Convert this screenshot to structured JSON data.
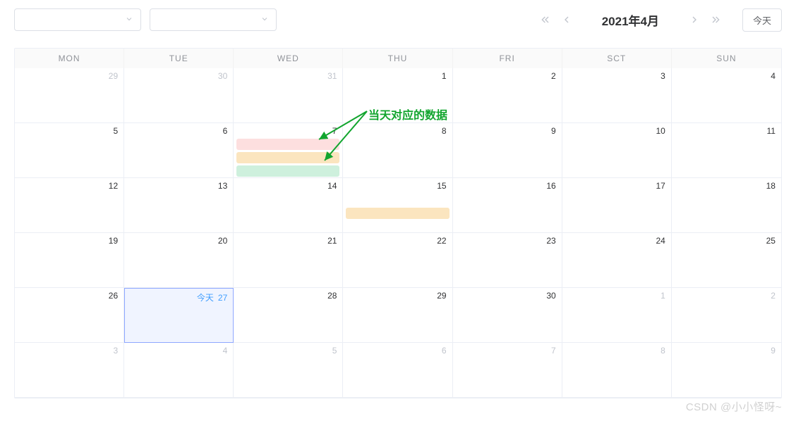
{
  "toolbar": {
    "select1_placeholder": " ",
    "select2_placeholder": " ",
    "month_label": "2021年4月",
    "today_button": "今天"
  },
  "weekdays": [
    "MON",
    "TUE",
    "WED",
    "THU",
    "FRI",
    "SCT",
    "SUN"
  ],
  "cells": [
    {
      "n": "29",
      "muted": true
    },
    {
      "n": "30",
      "muted": true
    },
    {
      "n": "31",
      "muted": true
    },
    {
      "n": "1"
    },
    {
      "n": "2"
    },
    {
      "n": "3"
    },
    {
      "n": "4"
    },
    {
      "n": "5"
    },
    {
      "n": "6"
    },
    {
      "n": "7",
      "events": [
        "pink",
        "orange",
        "green"
      ]
    },
    {
      "n": "8"
    },
    {
      "n": "9"
    },
    {
      "n": "10"
    },
    {
      "n": "11"
    },
    {
      "n": "12"
    },
    {
      "n": "13"
    },
    {
      "n": "14"
    },
    {
      "n": "15",
      "events": [
        "orange"
      ],
      "ev_top": true
    },
    {
      "n": "16"
    },
    {
      "n": "17"
    },
    {
      "n": "18"
    },
    {
      "n": "19"
    },
    {
      "n": "20"
    },
    {
      "n": "21"
    },
    {
      "n": "22"
    },
    {
      "n": "23"
    },
    {
      "n": "24"
    },
    {
      "n": "25"
    },
    {
      "n": "26"
    },
    {
      "n": "27",
      "today": true,
      "today_label": "今天"
    },
    {
      "n": "28"
    },
    {
      "n": "29"
    },
    {
      "n": "30"
    },
    {
      "n": "1",
      "muted": true
    },
    {
      "n": "2",
      "muted": true
    },
    {
      "n": "3",
      "muted": true
    },
    {
      "n": "4",
      "muted": true
    },
    {
      "n": "5",
      "muted": true
    },
    {
      "n": "6",
      "muted": true
    },
    {
      "n": "7",
      "muted": true
    },
    {
      "n": "8",
      "muted": true
    },
    {
      "n": "9",
      "muted": true
    }
  ],
  "annotation": {
    "text": "当天对应的数据"
  },
  "watermark": "CSDN @小小怪呀~"
}
